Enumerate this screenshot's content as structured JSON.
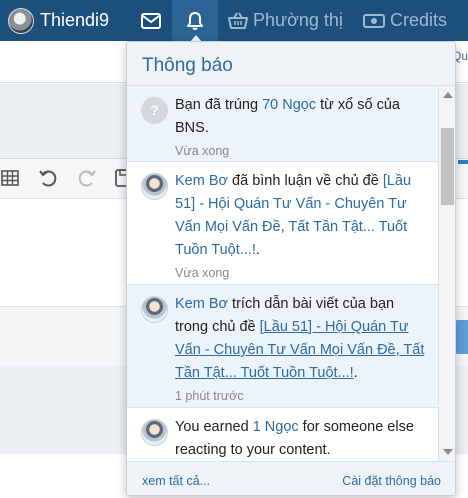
{
  "nav": {
    "username": "Thiendi9",
    "shop_label": "Phường thị",
    "credits_label": "Credits",
    "icons": {
      "mail": "mail-icon",
      "bell": "bell-icon",
      "shop": "basket-icon",
      "credits": "money-icon"
    },
    "colors": {
      "bar": "#1d4f7c",
      "active": "#2c6496",
      "muted": "#9fb8d1"
    }
  },
  "background": {
    "edge_text": "Qu"
  },
  "popup": {
    "title": "Thông báo",
    "notifications": [
      {
        "avatar": "question-avatar",
        "avatar_text": "?",
        "parts": [
          "Bạn đã trúng ",
          "70 Ngọc",
          " từ xổ số của BNS."
        ],
        "time": "Vừa xong"
      },
      {
        "avatar": "user-avatar",
        "user": "Kem Bơ",
        "text_before": " đã bình luận về chủ đề ",
        "thread": "[Lầu 51] - Hội Quán Tư Vấn - Chuyên Tư Vấn Mọi Vấn Đề, Tất Tần Tật... Tuốt Tuồn Tuột...!",
        "text_after": ".",
        "time": "Vừa xong"
      },
      {
        "avatar": "user-avatar",
        "user": "Kem Bơ",
        "text_before": " trích dẫn bài viết của bạn trong chủ đề ",
        "thread": "[Lầu 51] - Hội Quán Tư Vấn - Chuyên Tư Vấn Mọi Vấn Đề, Tất Tần Tật... Tuốt Tuồn Tuột...!",
        "text_after": ".",
        "time": "1 phút trước"
      },
      {
        "avatar": "user-avatar",
        "text_before": "You earned ",
        "amount": "1 Ngọc",
        "text_after": " for someone else reacting to your content."
      }
    ],
    "footer": {
      "see_all": "xem tất cả...",
      "settings": "Cài đặt thông báo"
    },
    "colors": {
      "header_bg": "#eef3f8",
      "link": "#2b6ca3",
      "unread_bg": "#edf3fa"
    }
  }
}
